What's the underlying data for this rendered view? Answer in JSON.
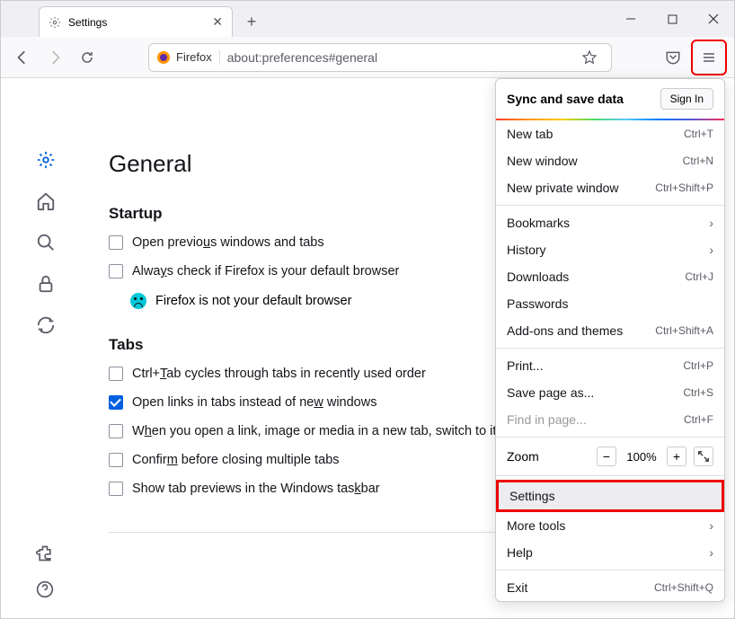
{
  "tab": {
    "title": "Settings"
  },
  "url": {
    "identity": "Firefox",
    "value": "about:preferences#general"
  },
  "page": {
    "title": "General",
    "startup": {
      "heading": "Startup",
      "prev": "Open previous windows and tabs",
      "default_check": "Always check if Firefox is your default browser",
      "not_default": "Firefox is not your default browser"
    },
    "tabs": {
      "heading": "Tabs",
      "cycle": "Ctrl+Tab cycles through tabs in recently used order",
      "openlinks": "Open links in tabs instead of new windows",
      "switch": "When you open a link, image or media in a new tab, switch to it immediately",
      "confirm": "Confirm before closing multiple tabs",
      "taskbar": "Show tab previews in the Windows taskbar"
    }
  },
  "menu": {
    "sync_title": "Sync and save data",
    "signin": "Sign In",
    "newtab": {
      "l": "New tab",
      "s": "Ctrl+T"
    },
    "newwin": {
      "l": "New window",
      "s": "Ctrl+N"
    },
    "newpriv": {
      "l": "New private window",
      "s": "Ctrl+Shift+P"
    },
    "bookmarks": "Bookmarks",
    "history": "History",
    "downloads": {
      "l": "Downloads",
      "s": "Ctrl+J"
    },
    "passwords": "Passwords",
    "addons": {
      "l": "Add-ons and themes",
      "s": "Ctrl+Shift+A"
    },
    "print": {
      "l": "Print...",
      "s": "Ctrl+P"
    },
    "save": {
      "l": "Save page as...",
      "s": "Ctrl+S"
    },
    "find": {
      "l": "Find in page...",
      "s": "Ctrl+F"
    },
    "zoom": {
      "l": "Zoom",
      "v": "100%"
    },
    "settings": "Settings",
    "moretools": "More tools",
    "help": "Help",
    "exit": {
      "l": "Exit",
      "s": "Ctrl+Shift+Q"
    }
  }
}
